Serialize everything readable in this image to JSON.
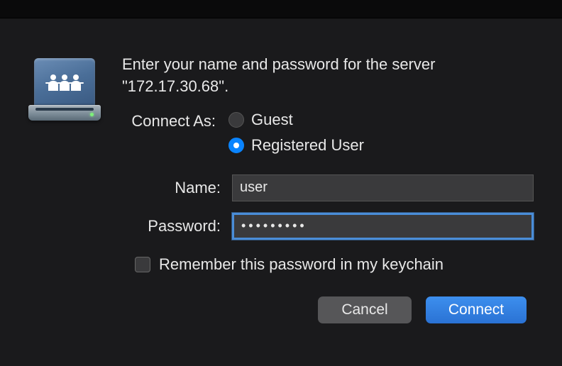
{
  "prompt": "Enter your name and password for the server \"172.17.30.68\".",
  "connectAs": {
    "label": "Connect As:",
    "options": {
      "guest": "Guest",
      "registered": "Registered User"
    },
    "selected": "registered"
  },
  "fields": {
    "name": {
      "label": "Name:",
      "value": "user"
    },
    "password": {
      "label": "Password:",
      "value": "•••••••••"
    }
  },
  "remember": {
    "label": "Remember this password in my keychain",
    "checked": false
  },
  "buttons": {
    "cancel": "Cancel",
    "connect": "Connect"
  }
}
